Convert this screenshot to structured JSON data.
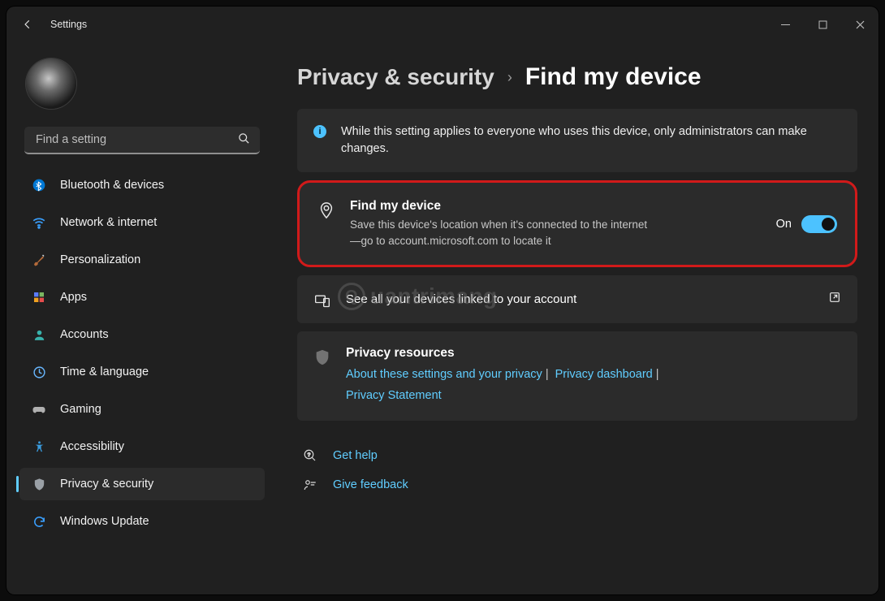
{
  "window": {
    "app_title": "Settings"
  },
  "search": {
    "placeholder": "Find a setting"
  },
  "sidebar": {
    "items": [
      {
        "label": "Bluetooth & devices"
      },
      {
        "label": "Network & internet"
      },
      {
        "label": "Personalization"
      },
      {
        "label": "Apps"
      },
      {
        "label": "Accounts"
      },
      {
        "label": "Time & language"
      },
      {
        "label": "Gaming"
      },
      {
        "label": "Accessibility"
      },
      {
        "label": "Privacy & security"
      },
      {
        "label": "Windows Update"
      }
    ]
  },
  "breadcrumb": {
    "parent": "Privacy & security",
    "current": "Find my device"
  },
  "info_banner": "While this setting applies to everyone who uses this device, only administrators can make changes.",
  "find_device": {
    "title": "Find my device",
    "description": "Save this device's location when it's connected to the internet—go to account.microsoft.com to locate it",
    "state_label": "On"
  },
  "linked_devices": {
    "label": "See all your devices linked to your account"
  },
  "resources": {
    "title": "Privacy resources",
    "link1": "About these settings and your privacy",
    "link2": "Privacy dashboard",
    "link3": "Privacy Statement"
  },
  "help": {
    "get_help": "Get help",
    "feedback": "Give feedback"
  },
  "watermark": "uantrimang"
}
